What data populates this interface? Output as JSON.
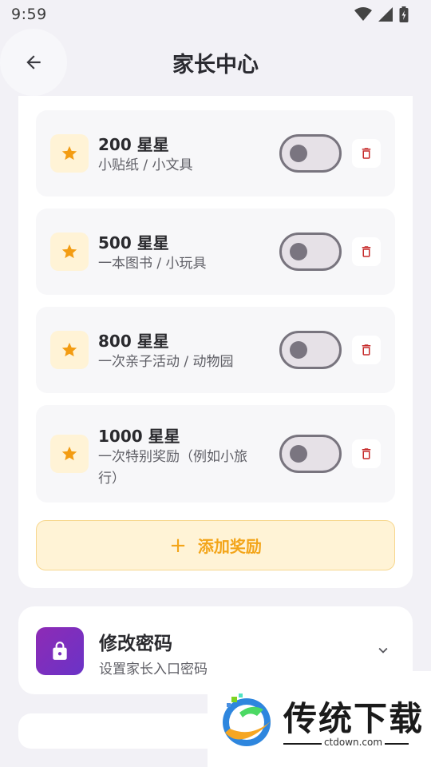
{
  "status_bar": {
    "time": "9:59",
    "icons": [
      "wifi-icon",
      "signal-icon",
      "battery-icon"
    ]
  },
  "header": {
    "title": "家长中心",
    "back_icon": "arrow-left-icon"
  },
  "rewards": [
    {
      "title": "200 星星",
      "description": "小贴纸 / 小文具",
      "enabled": false
    },
    {
      "title": "500 星星",
      "description": "一本图书 / 小玩具",
      "enabled": false
    },
    {
      "title": "800 星星",
      "description": "一次亲子活动 / 动物园",
      "enabled": false
    },
    {
      "title": "1000 星星",
      "description": "一次特别奖励（例如小旅行）",
      "enabled": false
    }
  ],
  "add_reward": {
    "label": "添加奖励",
    "icon": "plus-icon"
  },
  "password_section": {
    "title": "修改密码",
    "description": "设置家长入口密码",
    "icon": "lock-icon",
    "expand_icon": "chevron-down-icon"
  },
  "watermark": {
    "name": "传统下载",
    "url": "ctdown.com"
  },
  "colors": {
    "accent": "#f3a51a",
    "star": "#f39c12",
    "delete": "#c62828",
    "lock_gradient_start": "#8e2bb5",
    "lock_gradient_end": "#6a33c7"
  }
}
